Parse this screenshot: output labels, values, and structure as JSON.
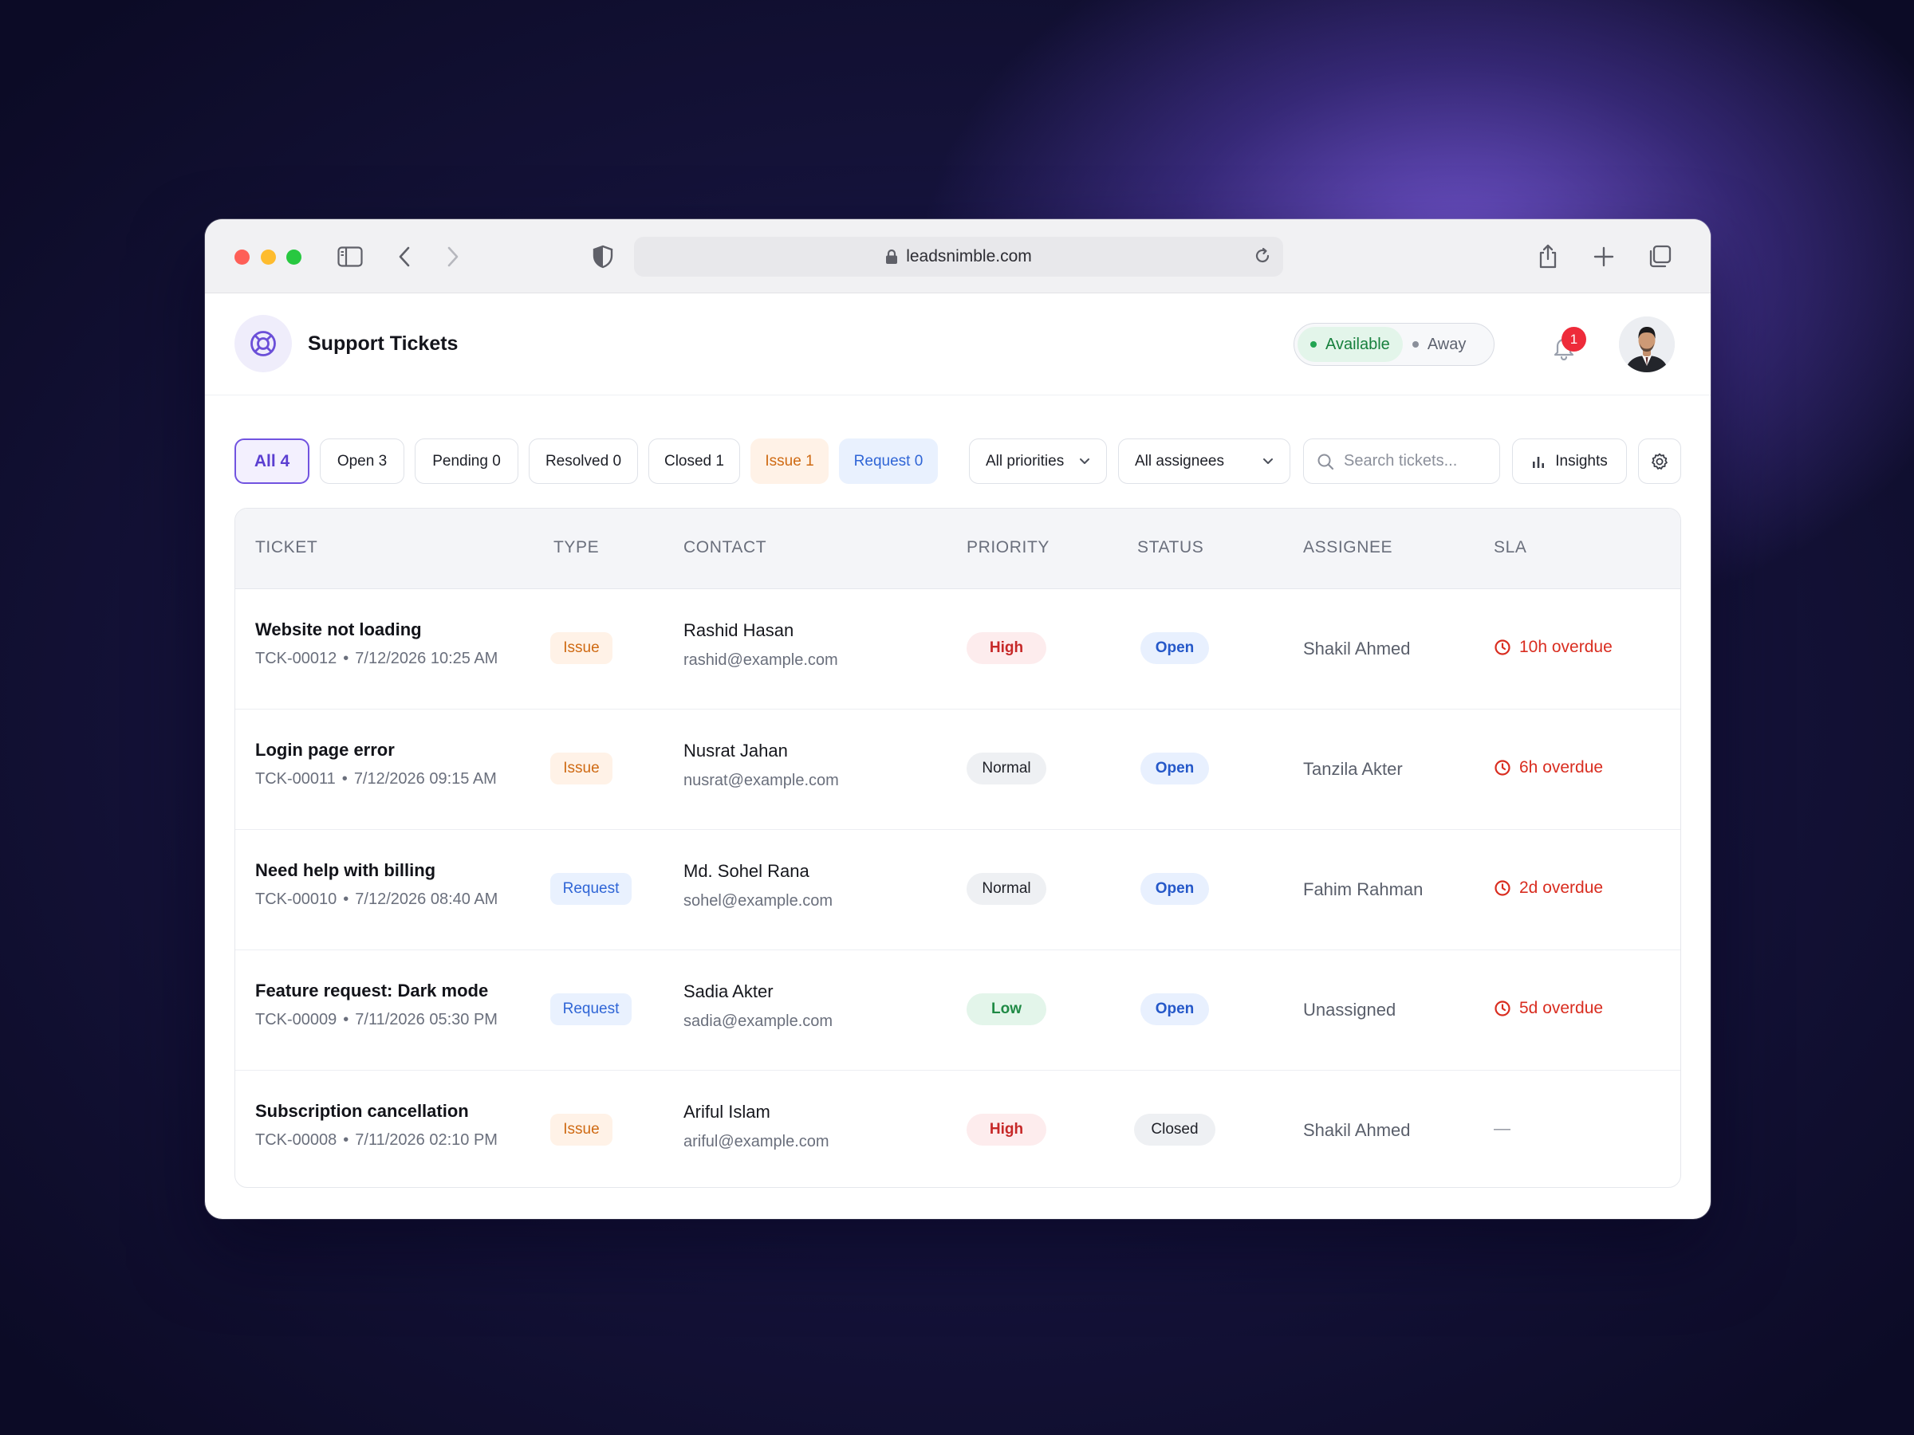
{
  "browser": {
    "url": "leadsnimble.com"
  },
  "app": {
    "title": "Support Tickets",
    "presence": {
      "available": "Available",
      "away": "Away"
    },
    "notifications_count": "1"
  },
  "filters": {
    "tabs": [
      {
        "label": "All",
        "count": "4"
      },
      {
        "label": "Open",
        "count": "3"
      },
      {
        "label": "Pending",
        "count": "0"
      },
      {
        "label": "Resolved",
        "count": "0"
      },
      {
        "label": "Closed",
        "count": "1"
      },
      {
        "label": "Issue",
        "count": "1"
      },
      {
        "label": "Request",
        "count": "0"
      }
    ],
    "priority_select": "All priorities",
    "assignee_select": "All assignees",
    "search_placeholder": "Search tickets...",
    "insights_label": "Insights"
  },
  "table": {
    "headers": [
      "TICKET",
      "TYPE",
      "CONTACT",
      "PRIORITY",
      "STATUS",
      "ASSIGNEE",
      "SLA"
    ],
    "rows": [
      {
        "title": "Website not loading",
        "id": "TCK-00012",
        "date": "7/12/2026 10:25 AM",
        "type": "Issue",
        "contact_name": "Rashid Hasan",
        "contact_email": "rashid@example.com",
        "priority": "High",
        "status": "Open",
        "assignee": "Shakil Ahmed",
        "sla": "10h overdue"
      },
      {
        "title": "Login page error",
        "id": "TCK-00011",
        "date": "7/12/2026 09:15 AM",
        "type": "Issue",
        "contact_name": "Nusrat Jahan",
        "contact_email": "nusrat@example.com",
        "priority": "Normal",
        "status": "Open",
        "assignee": "Tanzila Akter",
        "sla": "6h overdue"
      },
      {
        "title": "Need help with billing",
        "id": "TCK-00010",
        "date": "7/12/2026 08:40 AM",
        "type": "Request",
        "contact_name": "Md. Sohel Rana",
        "contact_email": "sohel@example.com",
        "priority": "Normal",
        "status": "Open",
        "assignee": "Fahim Rahman",
        "sla": "2d overdue"
      },
      {
        "title": "Feature request: Dark mode",
        "id": "TCK-00009",
        "date": "7/11/2026 05:30 PM",
        "type": "Request",
        "contact_name": "Sadia Akter",
        "contact_email": "sadia@example.com",
        "priority": "Low",
        "status": "Open",
        "assignee": "Unassigned",
        "sla": "5d overdue"
      },
      {
        "title": "Subscription cancellation",
        "id": "TCK-00008",
        "date": "7/11/2026 02:10 PM",
        "type": "Issue",
        "contact_name": "Ariful Islam",
        "contact_email": "ariful@example.com",
        "priority": "High",
        "status": "Closed",
        "assignee": "Shakil Ahmed",
        "sla": "—"
      }
    ]
  },
  "colors": {
    "accent": "#7153e0",
    "overdue": "#d92d20",
    "issue_text": "#cf6a13",
    "issue_bg": "#fff2e7",
    "request_text": "#2f65d6",
    "request_bg": "#e9f1fe",
    "high_text": "#c62828",
    "high_bg": "#fdeced",
    "normal_text": "#1f2128",
    "normal_bg": "#eef0f3",
    "low_text": "#1f8a45",
    "low_bg": "#e3f5ea",
    "open_text": "#2558c9",
    "open_bg": "#e8f0fe",
    "closed_text": "#1f2128",
    "closed_bg": "#eef0f3"
  },
  "icons": [
    "sidebar-icon",
    "back-icon",
    "forward-icon",
    "shield-icon",
    "lock-icon",
    "reload-icon",
    "share-icon",
    "new-tab-icon",
    "tabs-overview-icon",
    "lifebuoy-icon",
    "bell-icon",
    "search-icon",
    "chevron-down-icon",
    "bar-chart-icon",
    "gear-icon",
    "clock-icon"
  ]
}
